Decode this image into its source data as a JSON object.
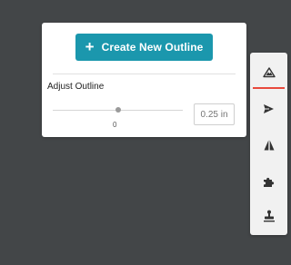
{
  "panel": {
    "create_button_label": "Create New Outline",
    "adjust_label": "Adjust Outline",
    "slider_value": "0",
    "slider_level": 0.5,
    "input_placeholder": "0.25 in"
  },
  "toolbar": {
    "tools": [
      {
        "name": "outline-icon",
        "active": true
      },
      {
        "name": "send-icon",
        "active": false
      },
      {
        "name": "mirror-icon",
        "active": false
      },
      {
        "name": "puzzle-icon",
        "active": false
      },
      {
        "name": "stamp-icon",
        "active": false
      }
    ]
  },
  "colors": {
    "background": "#434648",
    "accent": "#1b97ad",
    "active_indicator": "#e8493c"
  }
}
